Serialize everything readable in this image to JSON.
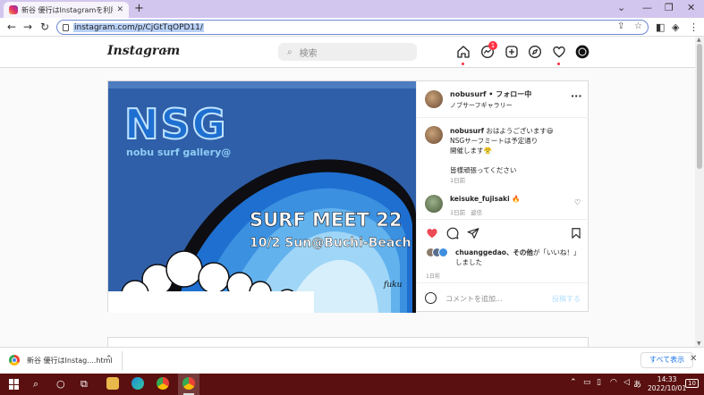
{
  "browser": {
    "tab_title": "新谷 優行はInstagramを利用してい",
    "url": "instagram.com/p/CjGtTqOPD11/",
    "new_tab_label": "+",
    "window_controls": [
      "⌄",
      "—",
      "❐",
      "✕"
    ]
  },
  "instagram": {
    "logo": "Instagram",
    "search_placeholder": "検索",
    "messenger_badge": "1"
  },
  "post": {
    "image_text": {
      "brand": "NSG",
      "tagline": "nobu surf gallery@",
      "event_title": "SURF MEET 22",
      "event_date": "10/2 Sun@Buchi-Beach",
      "signature": "fuku"
    },
    "header_user": "nobusurf",
    "header_follow": "• フォロー中",
    "header_sub": "ノブサーフギャラリー",
    "caption_user": "nobusurf",
    "caption_lines": [
      "おはようございます😃",
      "NSGサーフミートは予定通り",
      "開催します😤",
      "",
      "皆様頑張ってください"
    ],
    "caption_time": "1日前",
    "comment_user": "keisuke_fujisaki",
    "comment_emoji": "🔥",
    "comment_time": "1日前",
    "comment_reply": "返信",
    "likes_user": "chuanggedao",
    "likes_suffix": "、その他",
    "likes_text_rest": "が「いいね！」しました",
    "post_date": "1日前",
    "comment_placeholder": "コメントを追加...",
    "post_button": "投稿する"
  },
  "download_bar": {
    "file_name": "新谷 優行はInstag....html",
    "show_all": "すべて表示"
  },
  "taskbar": {
    "time": "14:33",
    "date": "2022/10/01",
    "ime": "あ",
    "notification_count": "10"
  },
  "colors": {
    "accent_blue": "#0095f6",
    "notification_red": "#ff3040",
    "like_red": "#ed4956",
    "taskbar_bg": "#5a1010"
  }
}
